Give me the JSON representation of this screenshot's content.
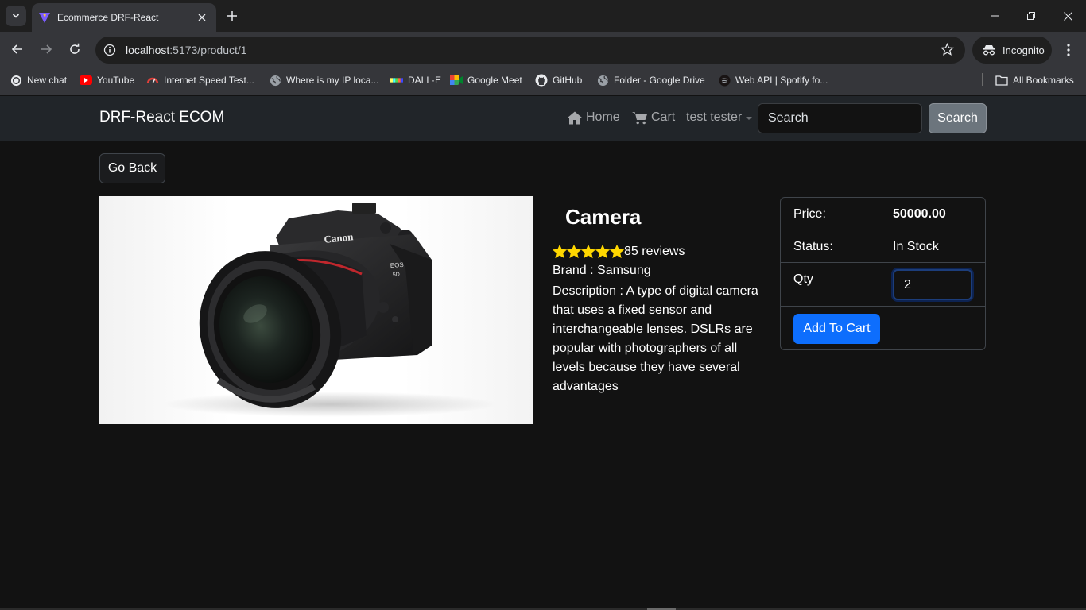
{
  "browser": {
    "tab_title": "Ecommerce DRF-React",
    "url_host": "localhost",
    "url_path": ":5173/product/1",
    "incognito_label": "Incognito",
    "bookmarks": [
      {
        "label": "New chat",
        "icon": "chatgpt-icon"
      },
      {
        "label": "YouTube",
        "icon": "youtube-icon"
      },
      {
        "label": "Internet Speed Test...",
        "icon": "speed-icon"
      },
      {
        "label": "Where is my IP loca...",
        "icon": "globe-icon"
      },
      {
        "label": "DALL·E",
        "icon": "dalle-icon"
      },
      {
        "label": "Google Meet",
        "icon": "meet-icon"
      },
      {
        "label": "GitHub",
        "icon": "github-icon"
      },
      {
        "label": "Folder - Google Drive",
        "icon": "globe-icon"
      },
      {
        "label": "Web API | Spotify fo...",
        "icon": "spotify-icon"
      }
    ],
    "all_bookmarks_label": "All Bookmarks"
  },
  "navbar": {
    "brand": "DRF-React ECOM",
    "home_label": "Home",
    "cart_label": "Cart",
    "user_label": "test tester",
    "search_placeholder": "Search",
    "search_button": "Search"
  },
  "page": {
    "go_back_label": "Go Back"
  },
  "product": {
    "name": "Camera",
    "rating": 5,
    "reviews_text": "85 reviews",
    "brand_text": "Brand : Samsung",
    "description_text": "Description : A type of digital camera that uses a fixed sensor and interchangeable lenses. DSLRs are popular with photographers of all levels because they have several advantages",
    "image_alt": "Canon EOS 5D Mark IV camera"
  },
  "purchase": {
    "price_label": "Price:",
    "price_value": "50000.00",
    "status_label": "Status:",
    "status_value": "In Stock",
    "qty_label": "Qty",
    "qty_value": "2",
    "add_to_cart_label": "Add To Cart"
  },
  "colors": {
    "accent": "#0d6efd",
    "star": "#ffd700",
    "navbar_bg": "#212529"
  }
}
